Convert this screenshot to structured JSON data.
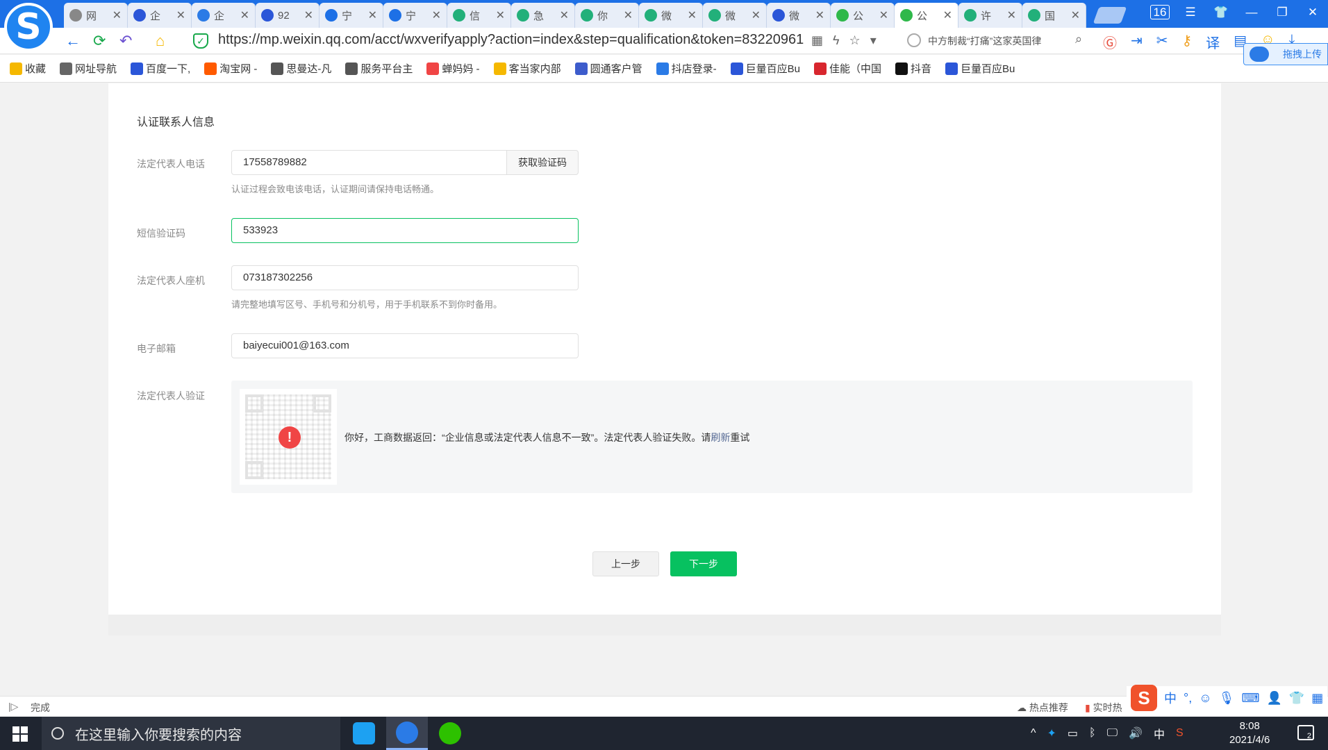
{
  "browser": {
    "tab_count": "16",
    "tabs": [
      {
        "label": "网",
        "color": "#888888"
      },
      {
        "label": "企",
        "color": "#2b56d8"
      },
      {
        "label": "企",
        "color": "#2b7be6"
      },
      {
        "label": "92",
        "color": "#2b56d8"
      },
      {
        "label": "宁",
        "color": "#1d70e6"
      },
      {
        "label": "宁",
        "color": "#1d70e6"
      },
      {
        "label": "信",
        "color": "#22b07a"
      },
      {
        "label": "急",
        "color": "#22b07a"
      },
      {
        "label": "你",
        "color": "#22b07a"
      },
      {
        "label": "微",
        "color": "#22b07a"
      },
      {
        "label": "微",
        "color": "#22b07a"
      },
      {
        "label": "微",
        "color": "#2b56d8"
      },
      {
        "label": "公",
        "color": "#2fb84a"
      },
      {
        "label": "公",
        "color": "#2fb84a"
      },
      {
        "label": "许",
        "color": "#22b07a"
      },
      {
        "label": "国",
        "color": "#22b07a"
      }
    ],
    "url": "https://mp.weixin.qq.com/acct/wxverifyapply?action=index&step=qualification&token=83220961",
    "news_text": "中方制裁“打痛”这家英国律",
    "upload_label": "拖拽上传",
    "bookmarks": [
      {
        "label": "收藏",
        "color": "#f5b800"
      },
      {
        "label": "网址导航",
        "color": "#666666"
      },
      {
        "label": "百度一下,",
        "color": "#2b56d8"
      },
      {
        "label": "淘宝网 -",
        "color": "#ff5a00"
      },
      {
        "label": "思曼达-凡",
        "color": "#555555"
      },
      {
        "label": "服务平台主",
        "color": "#555555"
      },
      {
        "label": "蝉妈妈 -",
        "color": "#f04545"
      },
      {
        "label": "客当家内部",
        "color": "#f5b800"
      },
      {
        "label": "圆通客户管",
        "color": "#3d5ccc"
      },
      {
        "label": "抖店登录-",
        "color": "#2b7be6"
      },
      {
        "label": "巨量百应Bu",
        "color": "#2b56d8"
      },
      {
        "label": "佳能（中国",
        "color": "#d8262e"
      },
      {
        "label": "抖音",
        "color": "#111111"
      },
      {
        "label": "巨量百应Bu",
        "color": "#2b56d8"
      }
    ]
  },
  "form": {
    "section_title": "认证联系人信息",
    "phone_label": "法定代表人电话",
    "phone_value": "17558789882",
    "get_code_label": "获取验证码",
    "phone_hint": "认证过程会致电该电话，认证期间请保持电话畅通。",
    "sms_label": "短信验证码",
    "sms_value": "533923",
    "landline_label": "法定代表人座机",
    "landline_value": "073187302256",
    "landline_hint": "请完整地填写区号、手机号和分机号，用于手机联系不到你时备用。",
    "email_label": "电子邮箱",
    "email_value": "baiyecui001@163.com",
    "verify_label": "法定代表人验证",
    "verify_msg_prefix": "你好，工商数据返回：“企业信息或法定代表人信息不一致”。法定代表人验证失败。请",
    "verify_msg_link": "刷新",
    "verify_msg_suffix": "重试",
    "prev_label": "上一步",
    "next_label": "下一步"
  },
  "statusbar": {
    "status": "完成",
    "hot": "热点推荐",
    "realtime": "实时热",
    "ime_mode": "中"
  },
  "taskbar": {
    "search_placeholder": "在这里输入你要搜索的内容",
    "tray_lang": "中",
    "time": "8:08",
    "date": "2021/4/6",
    "notification_count": "2"
  },
  "colors": {
    "accent_green": "#07c160",
    "link_blue": "#576b95",
    "error_red": "#f04545",
    "browser_blue": "#1d70e6"
  }
}
